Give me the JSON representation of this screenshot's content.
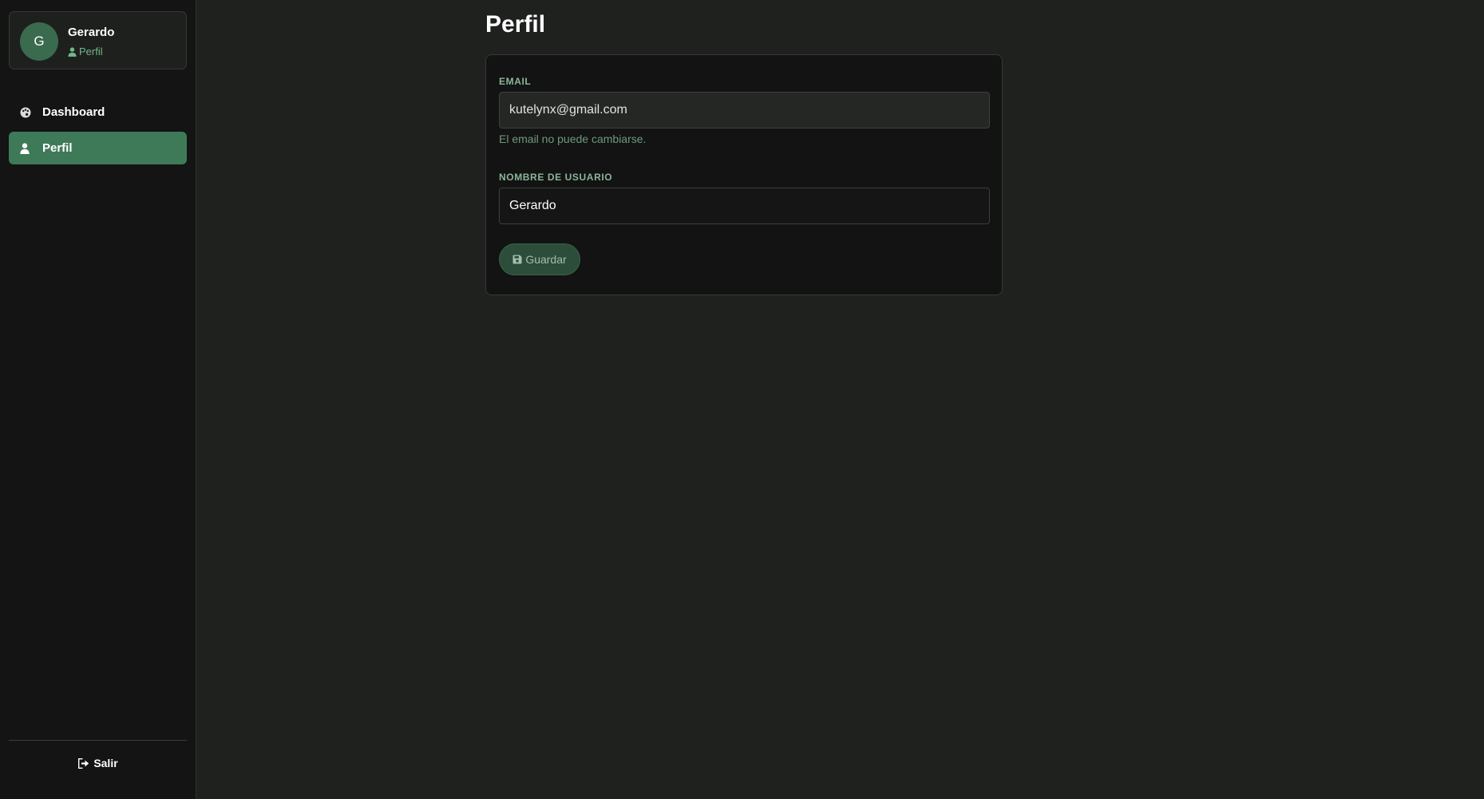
{
  "sidebar": {
    "user": {
      "initial": "G",
      "name": "Gerardo",
      "role": "Perfil",
      "role_icon": "user-icon"
    },
    "nav": [
      {
        "label": "Dashboard",
        "icon": "palette-icon",
        "active": false
      },
      {
        "label": "Perfil",
        "icon": "user-icon",
        "active": true
      }
    ],
    "logout": {
      "label": "Salir",
      "icon": "sign-out-icon"
    }
  },
  "main": {
    "title": "Perfil",
    "form": {
      "email": {
        "label": "EMAIL",
        "value": "kutelynx@gmail.com",
        "hint": "El email no puede cambiarse.",
        "disabled": true
      },
      "username": {
        "label": "NOMBRE DE USUARIO",
        "value": "Gerardo"
      },
      "save": {
        "label": "Guardar",
        "icon": "save-icon"
      }
    }
  },
  "colors": {
    "accent": "#3f7a58",
    "sidebar_bg": "#131413",
    "page_bg": "#1f211f",
    "card_bg": "#121312",
    "label": "#8bb59a"
  }
}
